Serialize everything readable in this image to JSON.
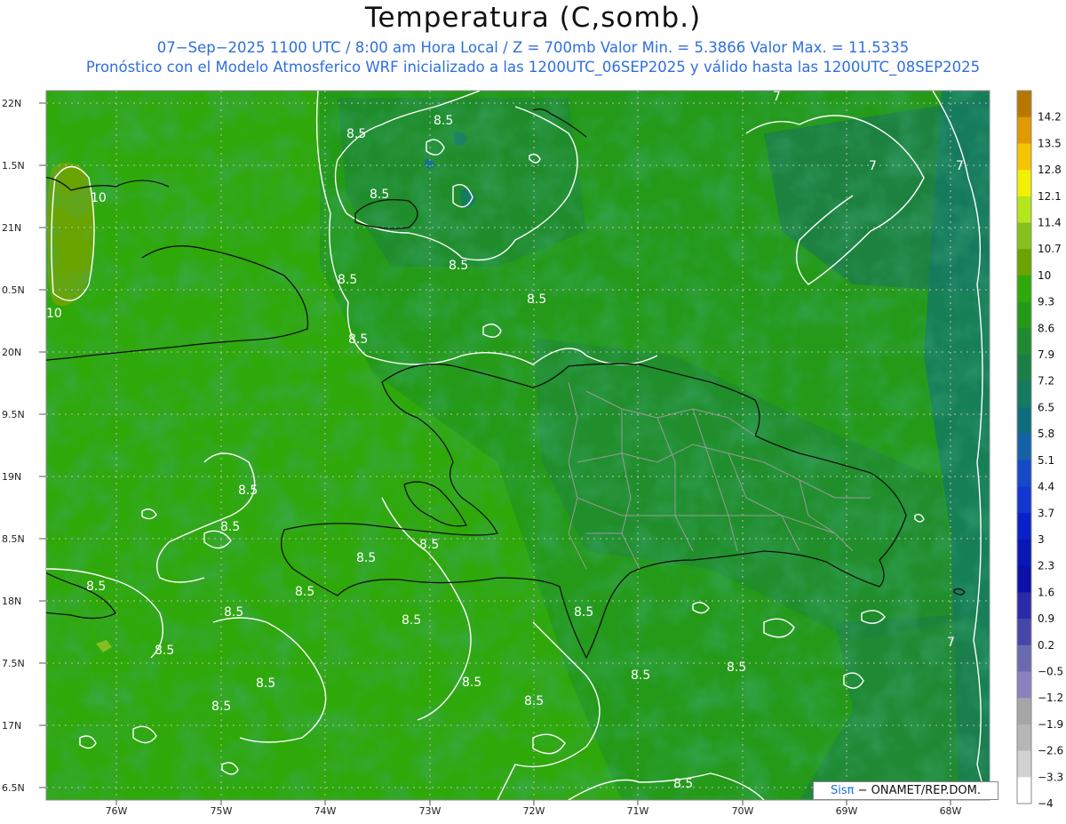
{
  "header": {
    "title": "Temperatura (C,somb.)",
    "line1": "07−Sep−2025  1100 UTC / 8:00 am Hora Local / Z = 700mb     Valor Min. = 5.3866  Valor Max. = 11.5335",
    "line2": "Pronóstico con el Modelo Atmosferico WRF inicializado a las 1200UTC_06SEP2025 y válido hasta las  1200UTC_08SEP2025"
  },
  "axes": {
    "lat_labels": [
      "22N",
      "1.5N",
      "21N",
      "0.5N",
      "20N",
      "9.5N",
      "19N",
      "8.5N",
      "18N",
      "7.5N",
      "17N",
      "6.5N"
    ],
    "lon_labels": [
      "76W",
      "75W",
      "74W",
      "73W",
      "72W",
      "71W",
      "70W",
      "69W",
      "68W"
    ]
  },
  "contour_labels": [
    "8.5",
    "8.5",
    "8.5",
    "8.5",
    "8.5",
    "8.5",
    "10",
    "10",
    "7",
    "7",
    "7",
    "7",
    "8.5",
    "8.5",
    "8.5",
    "8.5",
    "8.5",
    "8.5",
    "8.5",
    "8.5",
    "8.5",
    "8.5",
    "8.5",
    "8.5",
    "8.5",
    "8.5",
    "8.5",
    "8.5",
    "8.5",
    "8.5"
  ],
  "colorbar": {
    "labels": [
      "14.2",
      "13.5",
      "12.8",
      "12.1",
      "11.4",
      "10.7",
      "10",
      "9.3",
      "8.6",
      "7.9",
      "7.2",
      "6.5",
      "5.8",
      "5.1",
      "4.4",
      "3.7",
      "3",
      "2.3",
      "1.6",
      "0.9",
      "0.2",
      "−0.5",
      "−1.2",
      "−1.9",
      "−2.6",
      "−3.3",
      "−4"
    ],
    "colors": [
      "#b87800",
      "#e09a00",
      "#f5c400",
      "#f2f000",
      "#b5e61d",
      "#86c01b",
      "#6aa400",
      "#2fa80a",
      "#249a18",
      "#1f8a32",
      "#1c7e46",
      "#157a62",
      "#0f6e7e",
      "#1660a8",
      "#1549c7",
      "#1236d0",
      "#0a20c8",
      "#0818b5",
      "#0b10a8",
      "#2a2aa8",
      "#4646a8",
      "#6a6ab0",
      "#8a82bc",
      "#a6a6a6",
      "#b6b6b6",
      "#d2d2d2",
      "#ffffff"
    ]
  },
  "credit": {
    "logo": "Sisπ",
    "text": "− ONAMET/REP.DOM."
  }
}
